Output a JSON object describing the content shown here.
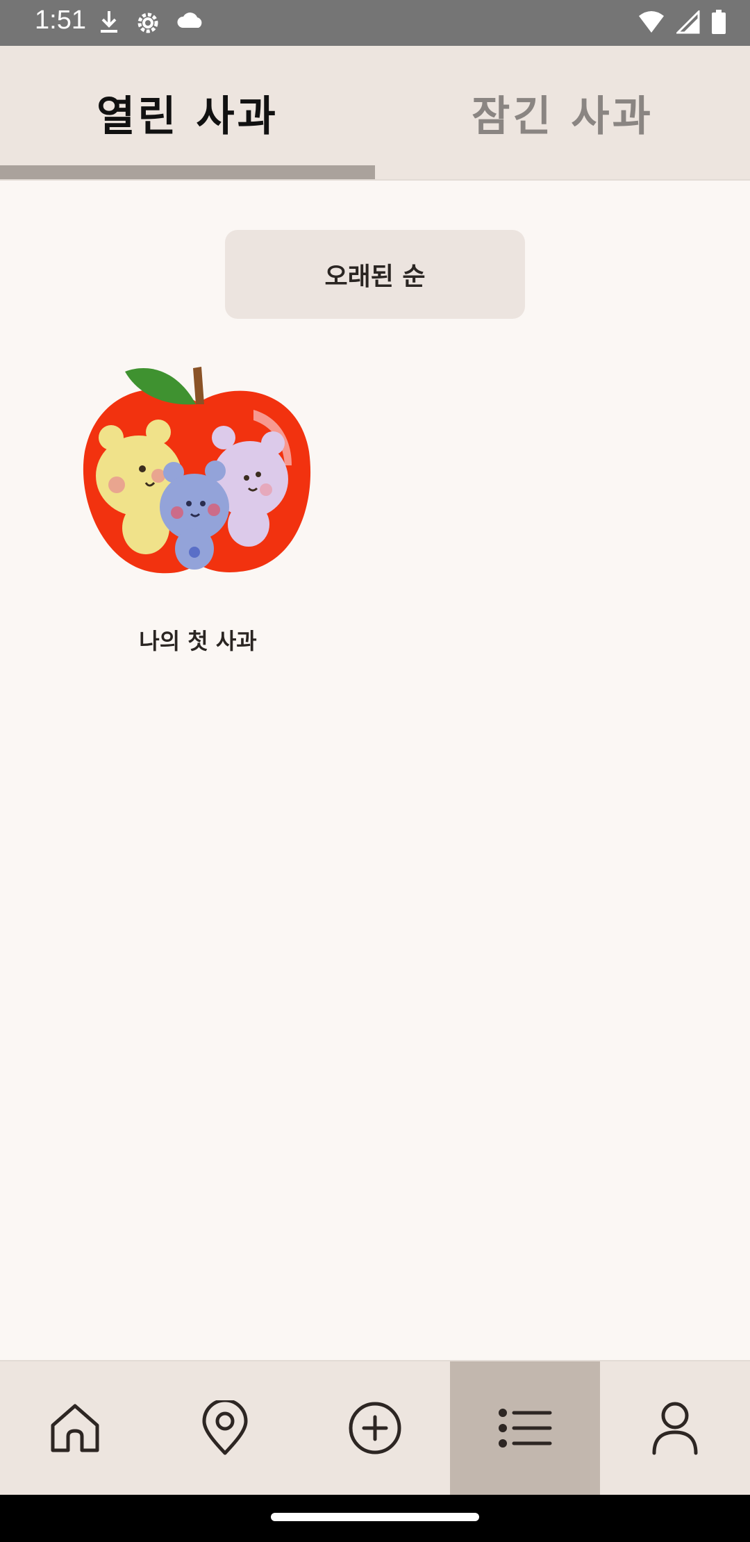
{
  "status_bar": {
    "time": "1:51",
    "icons_left": [
      "download-icon",
      "settings-icon",
      "cloud-icon"
    ],
    "icons_right": [
      "wifi-icon",
      "signal-icon",
      "battery-icon"
    ]
  },
  "tabs": [
    {
      "label": "열린 사과",
      "active": true
    },
    {
      "label": "잠긴 사과",
      "active": false
    }
  ],
  "sort_button": {
    "label": "오래된 순"
  },
  "apples": [
    {
      "label": "나의 첫 사과",
      "image": "apple-with-bears"
    }
  ],
  "bottom_nav": [
    {
      "name": "home-icon",
      "active": false
    },
    {
      "name": "location-pin-icon",
      "active": false
    },
    {
      "name": "add-circle-icon",
      "active": false
    },
    {
      "name": "list-icon",
      "active": true
    },
    {
      "name": "person-icon",
      "active": false
    }
  ],
  "colors": {
    "background": "#fbf7f4",
    "tab_bar": "#ede5df",
    "indicator": "#aaa29c",
    "nav_active": "#c2b7ae",
    "status_bar": "#757575"
  }
}
